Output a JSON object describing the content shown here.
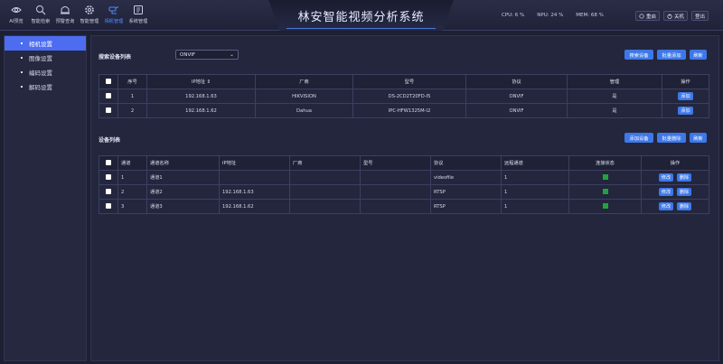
{
  "header": {
    "title": "林安智能视频分析系统",
    "nav": [
      {
        "label": "AI预览",
        "icon": "ai-preview-icon"
      },
      {
        "label": "智能检索",
        "icon": "search-icon"
      },
      {
        "label": "预警查询",
        "icon": "alarm-query-icon"
      },
      {
        "label": "智能管理",
        "icon": "gear-icon"
      },
      {
        "label": "相机管理",
        "icon": "camera-icon"
      },
      {
        "label": "系统管理",
        "icon": "system-icon"
      }
    ],
    "stats": {
      "cpu": "CPU: 6 %",
      "npu": "NPU: 24 %",
      "mem": "MEM: 68 %"
    },
    "buttons": {
      "restart": "重启",
      "shutdown": "关机",
      "logout": "登出"
    }
  },
  "sidebar": {
    "items": [
      {
        "label": "相机设置",
        "active": true
      },
      {
        "label": "图像设置",
        "active": false
      },
      {
        "label": "编码设置",
        "active": false
      },
      {
        "label": "解码设置",
        "active": false
      }
    ]
  },
  "search": {
    "title": "搜索设备列表",
    "protocol_value": "ONVIF",
    "buttons": {
      "search": "搜索设备",
      "batch_add": "批量添加",
      "refresh": "刷新"
    },
    "columns": [
      "序号",
      "IP地址 ⇕",
      "厂商",
      "型号",
      "协议",
      "管理",
      "操作"
    ],
    "rows": [
      {
        "no": "1",
        "ip": "192.168.1.63",
        "vendor": "HIKVISION",
        "model": "DS-2CD2T20FD-I5",
        "protocol": "ONVIF",
        "manage": "是",
        "action": "添加"
      },
      {
        "no": "2",
        "ip": "192.168.1.62",
        "vendor": "Dahua",
        "model": "IPC-HFW1325M-I2",
        "protocol": "ONVIF",
        "manage": "是",
        "action": "添加"
      }
    ]
  },
  "devices": {
    "title": "设备列表",
    "buttons": {
      "add": "添加设备",
      "batch_delete": "批量删除",
      "refresh": "刷新"
    },
    "columns": [
      "通道",
      "通道名称",
      "IP地址",
      "厂商",
      "型号",
      "协议",
      "远程通道",
      "连接状态",
      "操作"
    ],
    "edit_label": "修改",
    "delete_label": "删除",
    "status_color": "#1ea53a",
    "rows": [
      {
        "channel": "1",
        "name": "通道1",
        "ip": "",
        "vendor": "",
        "model": "",
        "protocol": "videofile",
        "remote": "1",
        "status": "connected"
      },
      {
        "channel": "2",
        "name": "通道2",
        "ip": "192.168.1.63",
        "vendor": "",
        "model": "",
        "protocol": "RTSP",
        "remote": "1",
        "status": "connected"
      },
      {
        "channel": "3",
        "name": "通道3",
        "ip": "192.168.1.62",
        "vendor": "",
        "model": "",
        "protocol": "RTSP",
        "remote": "1",
        "status": "connected"
      }
    ]
  },
  "colors": {
    "accent": "#3d78e8",
    "active_sidebar": "#4d6cf0",
    "background": "#1d1f33"
  }
}
